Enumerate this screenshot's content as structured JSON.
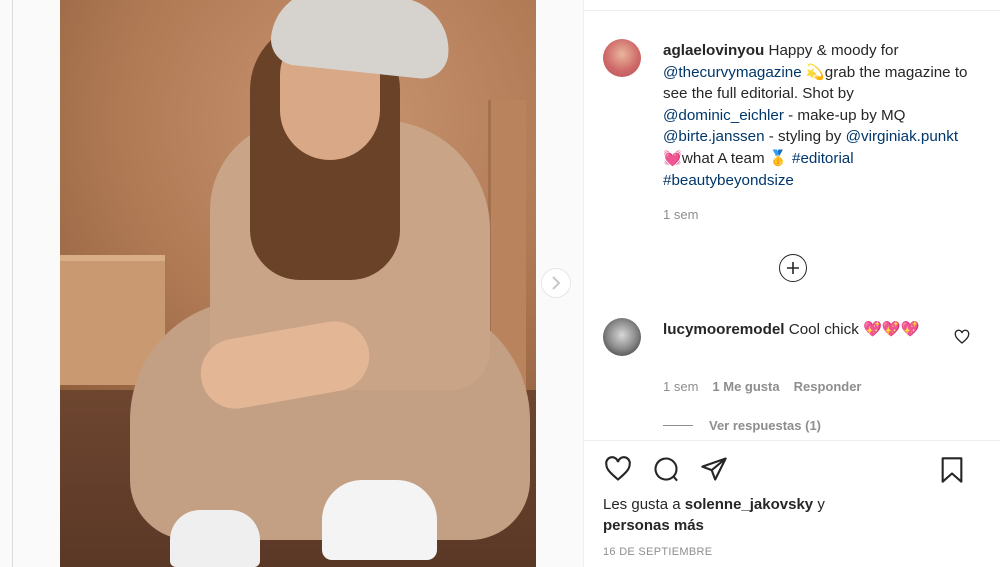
{
  "post": {
    "author": "aglaelovinyou",
    "caption_parts": [
      {
        "t": "aglaelovinyou",
        "k": "user"
      },
      {
        "t": " Happy & moody for ",
        "k": "text"
      },
      {
        "t": "@thecurvymagazine",
        "k": "link"
      },
      {
        "t": " 💫grab the magazine to see the full editorial. Shot by ",
        "k": "text"
      },
      {
        "t": "@dominic_eichler",
        "k": "link"
      },
      {
        "t": " - make-up by MQ ",
        "k": "text"
      },
      {
        "t": "@birte.janssen",
        "k": "link"
      },
      {
        "t": " - styling by ",
        "k": "text"
      },
      {
        "t": "@virginiak.punkt",
        "k": "link"
      },
      {
        "t": " 💓what A team 🥇 ",
        "k": "text"
      },
      {
        "t": "#editorial",
        "k": "link"
      },
      {
        "t": " ",
        "k": "text"
      },
      {
        "t": "#beautybeyondsize",
        "k": "link"
      }
    ],
    "time": "1 sem"
  },
  "comment": {
    "user": "lucymooremodel",
    "text": " Cool chick 💖💖💖",
    "time": "1 sem",
    "likes": "1 Me gusta",
    "reply": "Responder",
    "view_replies": "Ver respuestas (1)"
  },
  "likes": {
    "prefix": "Les gusta a ",
    "user": "solenne_jakovsky",
    "mid": " y ",
    "others": "personas más"
  },
  "date": "16 DE SEPTIEMBRE",
  "icons": {
    "heart": "heart-icon",
    "comment": "comment-icon",
    "share": "share-icon",
    "bookmark": "bookmark-icon",
    "add": "plus-circle-icon",
    "next": "chevron-right-icon"
  },
  "colors": {
    "link": "#00376b",
    "muted": "#8e8e8e",
    "text": "#262626"
  }
}
